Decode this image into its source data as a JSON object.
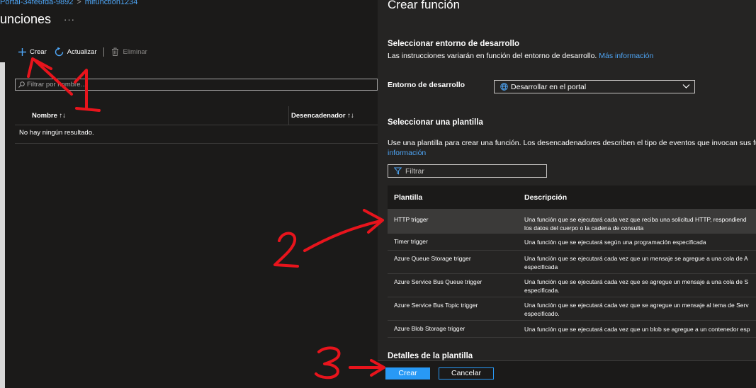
{
  "left": {
    "breadcrumb": [
      "Portal-34fe6fda-9892",
      "mifunction1234"
    ],
    "title": "unciones",
    "more": "···",
    "toolbar": {
      "create": "Crear",
      "refresh": "Actualizar",
      "delete": "Eliminar"
    },
    "filter_placeholder": "Filtrar por nombre...",
    "table": {
      "columns": [
        "Nombre ↑↓",
        "Desencadenador ↑↓"
      ],
      "empty": "No hay ningún resultado."
    }
  },
  "panel": {
    "title": "Crear función",
    "env_section": {
      "title": "Seleccionar entorno de desarrollo",
      "desc": "Las instrucciones variarán en función del entorno de desarrollo.",
      "more_link": "Más información"
    },
    "env_field": {
      "label": "Entorno de desarrollo",
      "value": "Desarrollar en el portal"
    },
    "template_section": {
      "title": "Seleccionar una plantilla",
      "desc_line1": "Use una plantilla para crear una función. Los desencadenadores describen el tipo de eventos que invocan sus fun",
      "more_link": "información"
    },
    "filter_placeholder": "Filtrar",
    "table": {
      "headers": [
        "Plantilla",
        "Descripción"
      ],
      "rows": [
        {
          "name": "HTTP trigger",
          "desc1": "Una función que se ejecutará cada vez que reciba una solicitud HTTP, respondiend",
          "desc2": "los datos del cuerpo o la cadena de consulta"
        },
        {
          "name": "Timer trigger",
          "desc1": "Una función que se ejecutará según una programación especificada",
          "desc2": ""
        },
        {
          "name": "Azure Queue Storage trigger",
          "desc1": "Una función que se ejecutará cada vez que un mensaje se agregue a una cola de A",
          "desc2": "especificada"
        },
        {
          "name": "Azure Service Bus Queue trigger",
          "desc1": "Una función que se ejecutará cada vez que se agregue un mensaje a una cola de S",
          "desc2": "especificada."
        },
        {
          "name": "Azure Service Bus Topic trigger",
          "desc1": "Una función que se ejecutará cada vez que se agregue un mensaje al tema de Serv",
          "desc2": "especificado."
        },
        {
          "name": "Azure Blob Storage trigger",
          "desc1": "Una función que se ejecutará cada vez que un blob se agregue a un contenedor esp",
          "desc2": ""
        }
      ]
    },
    "details_title": "Detalles de la plantilla",
    "buttons": {
      "create": "Crear",
      "cancel": "Cancelar"
    }
  },
  "colors": {
    "accent": "#2899f5",
    "link": "#4ea5f5",
    "panel_bg": "#252423",
    "page_bg": "#1b1a19",
    "annotation": "#e8141c"
  }
}
